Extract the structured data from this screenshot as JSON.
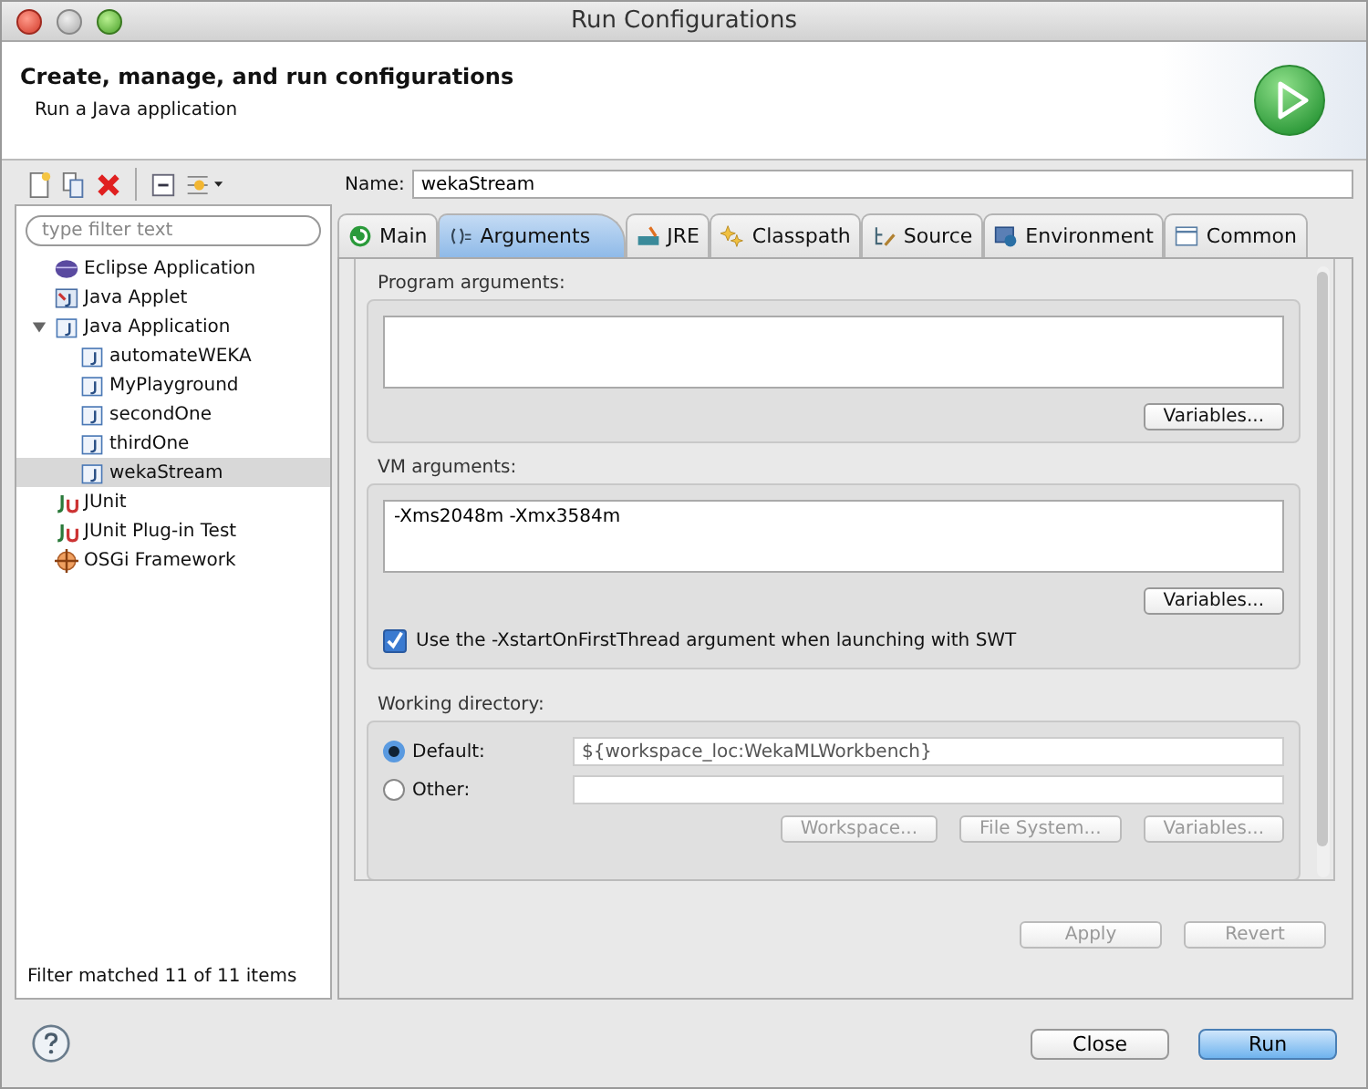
{
  "window": {
    "title": "Run Configurations"
  },
  "header": {
    "title": "Create, manage, and run configurations",
    "subtitle": "Run a Java application"
  },
  "sidebar": {
    "filter": {
      "placeholder": "type filter text"
    },
    "tree": [
      {
        "label": "Eclipse Application",
        "kind": "eclipse",
        "selected": false
      },
      {
        "label": "Java Applet",
        "kind": "applet",
        "selected": false
      },
      {
        "label": "Java Application",
        "kind": "java",
        "selected": false,
        "expanded": true,
        "children": [
          {
            "label": "automateWEKA",
            "kind": "java",
            "selected": false
          },
          {
            "label": "MyPlayground",
            "kind": "java",
            "selected": false
          },
          {
            "label": "secondOne",
            "kind": "java",
            "selected": false
          },
          {
            "label": "thirdOne",
            "kind": "java",
            "selected": false
          },
          {
            "label": "wekaStream",
            "kind": "java",
            "selected": true
          }
        ]
      },
      {
        "label": "JUnit",
        "kind": "junit",
        "selected": false
      },
      {
        "label": "JUnit Plug-in Test",
        "kind": "junit",
        "selected": false
      },
      {
        "label": "OSGi Framework",
        "kind": "osgi",
        "selected": false
      }
    ],
    "status": "Filter matched 11 of 11 items"
  },
  "name": {
    "label": "Name:",
    "value": "wekaStream"
  },
  "tabs": [
    {
      "label": "Main",
      "kind": "main",
      "selected": false
    },
    {
      "label": "Arguments",
      "kind": "arguments",
      "selected": true
    },
    {
      "label": "JRE",
      "kind": "jre",
      "selected": false
    },
    {
      "label": "Classpath",
      "kind": "classpath",
      "selected": false
    },
    {
      "label": "Source",
      "kind": "source",
      "selected": false
    },
    {
      "label": "Environment",
      "kind": "environment",
      "selected": false
    },
    {
      "label": "Common",
      "kind": "common",
      "selected": false
    }
  ],
  "program_arguments": {
    "label": "Program arguments:",
    "button": {
      "label": "Variables...",
      "disabled": false
    }
  },
  "vm_arguments": {
    "label": "VM arguments:",
    "value": "-Xms2048m -Xmx3584m",
    "button": {
      "label": "Variables...",
      "disabled": false
    }
  },
  "swt_option": {
    "label": "Use the -XstartOnFirstThread argument when launching with SWT",
    "checked": true
  },
  "working_directory": {
    "label": "Working directory:",
    "options": [
      {
        "label": "Default:",
        "selected": true,
        "value": "${workspace_loc:WekaMLWorkbench}",
        "disabled": true
      },
      {
        "label": "Other:",
        "selected": false,
        "disabled": false
      }
    ],
    "buttons": [
      {
        "label": "Workspace...",
        "disabled": true
      },
      {
        "label": "File System...",
        "disabled": true
      },
      {
        "label": "Variables...",
        "disabled": true
      }
    ]
  },
  "actions": [
    {
      "label": "Apply",
      "disabled": true
    },
    {
      "label": "Revert",
      "disabled": true
    }
  ],
  "footer_buttons": [
    {
      "label": "Close",
      "kind": "normal"
    },
    {
      "label": "Run",
      "kind": "default"
    }
  ]
}
